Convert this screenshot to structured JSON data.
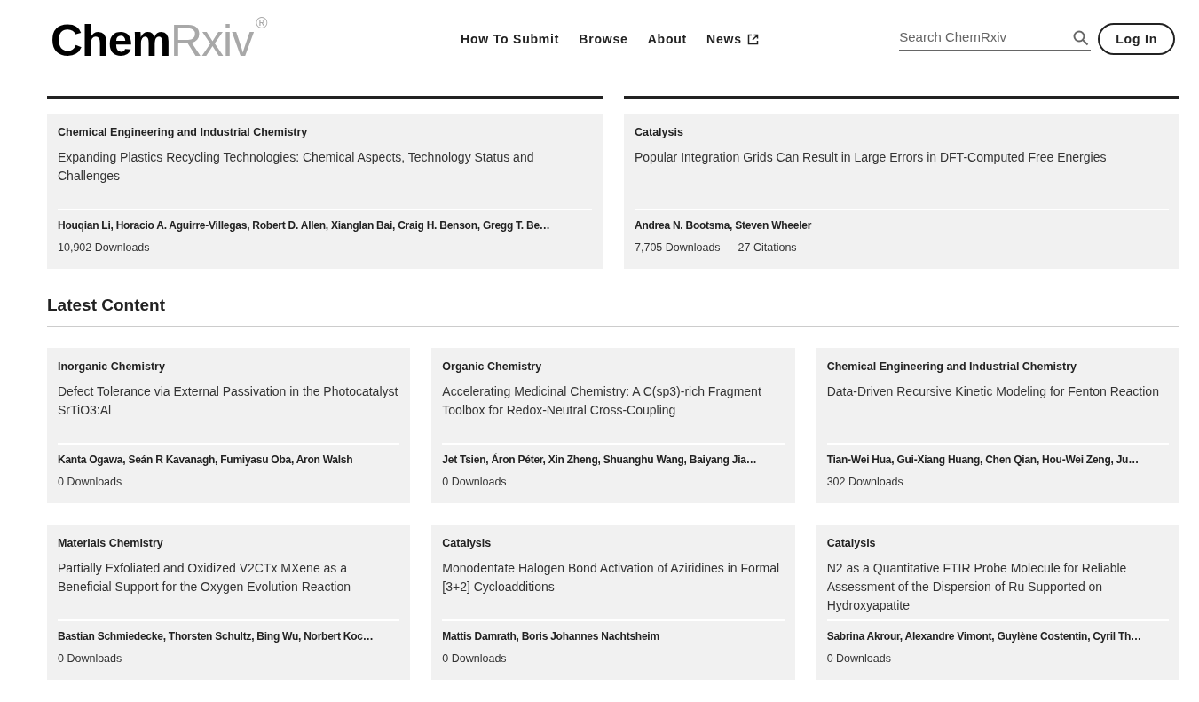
{
  "logo": {
    "bold": "Chem",
    "light": "Rxiv",
    "mark": "®"
  },
  "nav": [
    {
      "label": "How To Submit",
      "external": false
    },
    {
      "label": "Browse",
      "external": false
    },
    {
      "label": "About",
      "external": false
    },
    {
      "label": "News",
      "external": true
    }
  ],
  "search": {
    "placeholder": "Search ChemRxiv"
  },
  "login_button": "Log In",
  "featured": [
    {
      "category": "Chemical Engineering and Industrial Chemistry",
      "title": "Expanding Plastics Recycling Technologies: Chemical Aspects, Technology Status and Challenges",
      "authors": "Houqian Li, Horacio A. Aguirre-Villegas, Robert D. Allen, Xianglan Bai, Craig H. Benson, Gregg T. Be…",
      "stats": [
        "10,902 Downloads"
      ]
    },
    {
      "category": "Catalysis",
      "title": "Popular Integration Grids Can Result in Large Errors in DFT-Computed Free Energies",
      "authors": "Andrea N. Bootsma, Steven Wheeler",
      "stats": [
        "7,705 Downloads",
        "27 Citations"
      ]
    }
  ],
  "latest": {
    "heading": "Latest Content",
    "cards": [
      {
        "category": "Inorganic Chemistry",
        "title": "Defect Tolerance via External Passivation in the Photocatalyst SrTiO3:Al",
        "authors": "Kanta Ogawa, Seán R Kavanagh, Fumiyasu Oba, Aron Walsh",
        "stats": [
          "0 Downloads"
        ]
      },
      {
        "category": "Organic Chemistry",
        "title": "Accelerating Medicinal Chemistry: A C(sp3)-rich Fragment Toolbox for Redox-Neutral Cross-Coupling",
        "authors": "Jet Tsien, Áron Péter, Xin Zheng, Shuanghu Wang, Baiyang Jia…",
        "stats": [
          "0 Downloads"
        ]
      },
      {
        "category": "Chemical Engineering and Industrial Chemistry",
        "title": "Data-Driven Recursive Kinetic Modeling for Fenton Reaction",
        "authors": "Tian-Wei Hua, Gui-Xiang Huang, Chen Qian, Hou-Wei Zeng, Ju…",
        "stats": [
          "302 Downloads"
        ]
      },
      {
        "category": "Materials Chemistry",
        "title": "Partially Exfoliated and Oxidized V2CTx MXene as a Beneficial Support for the Oxygen Evolution Reaction",
        "authors": "Bastian Schmiedecke, Thorsten Schultz, Bing Wu, Norbert Koc…",
        "stats": [
          "0 Downloads"
        ]
      },
      {
        "category": "Catalysis",
        "title": "Monodentate Halogen Bond Activation of Aziridines in Formal [3+2] Cycloadditions",
        "authors": "Mattis Damrath, Boris Johannes Nachtsheim",
        "stats": [
          "0 Downloads"
        ]
      },
      {
        "category": "Catalysis",
        "title": "N2 as a Quantitative FTIR Probe Molecule for Reliable Assessment of the Dispersion of Ru Supported on Hydroxyapatite",
        "authors": "Sabrina Akrour, Alexandre Vimont, Guylène Costentin, Cyril Th…",
        "stats": [
          "0 Downloads"
        ]
      }
    ]
  }
}
